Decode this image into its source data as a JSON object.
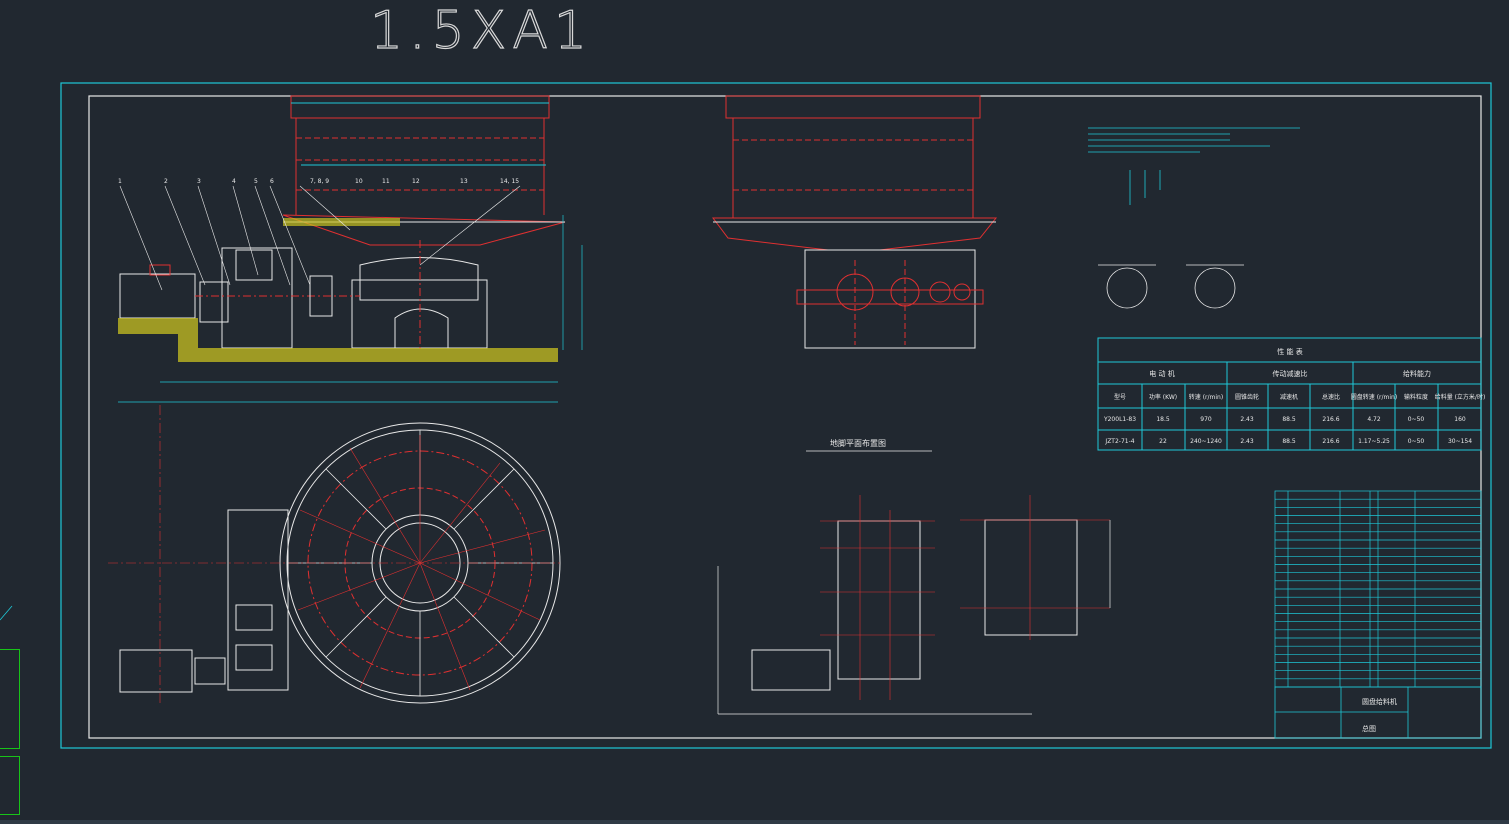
{
  "drawing": {
    "big_title": "1.5XA1",
    "elevation_callouts": [
      "1",
      "2",
      "3",
      "4",
      "5",
      "6",
      "7, 8, 9",
      "10",
      "11",
      "12",
      "13",
      "14, 15"
    ],
    "foundation_plan_title": "地脚平面布置图",
    "spec_table": {
      "title": "性 能 表",
      "group_headers": [
        "电 动 机",
        "传动减速比",
        "给料能力"
      ],
      "columns": [
        "型号",
        "功率 (KW)",
        "转速 (r/min)",
        "圆锥齿轮",
        "减速机",
        "总速比",
        "圆盘转速 (r/min)",
        "输料粒度",
        "给料量 (立方米/时)"
      ],
      "rows": [
        [
          "Y200L1-83",
          "18.5",
          "970",
          "2.43",
          "88.5",
          "216.6",
          "4.72",
          "0~50",
          "160"
        ],
        [
          "JZT2-71-4",
          "22",
          "240~1240",
          "2.43",
          "88.5",
          "216.6",
          "1.17~5.25",
          "0~50",
          "30~154"
        ]
      ]
    },
    "title_block": {
      "name": "圆盘给料机",
      "drawing_type": "总图"
    }
  }
}
